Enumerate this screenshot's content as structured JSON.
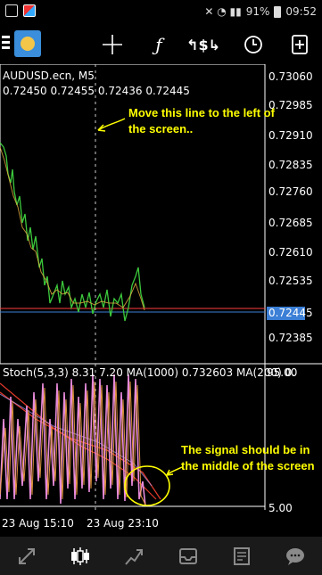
{
  "status_bar": {
    "battery": "91%",
    "time": "09:52"
  },
  "toolbar": {
    "crosshair_icon": "crosshair-icon",
    "indicators_icon": "function-icon",
    "trade_icon": "dollar-arrows-icon",
    "timeframe_icon": "clock-icon",
    "add_icon": "add-document-icon"
  },
  "chart": {
    "instrument": "AUDUSD.ecn, M5",
    "ohlc": "0.72450 0.72455 0.72436 0.72445",
    "current_price": "0.72445",
    "price_axis": [
      "0.73060",
      "0.72985",
      "0.72910",
      "0.72835",
      "0.72760",
      "0.72685",
      "0.72610",
      "0.72535",
      "0.72385"
    ],
    "stoch_label": "Stoch(5,3,3) 8.31 7.20 MA(1000) 0.732603 MA(200) 0.",
    "stoch_axis_top": "95.00",
    "stoch_axis_bottom": "5.00",
    "time_labels": [
      "23 Aug 15:10",
      "23 Aug 23:10"
    ],
    "colors": {
      "bid_line": "#ff3b3b",
      "ask_line": "#3b7fd6",
      "ma_red": "#e23a2a",
      "stoch_pink": "#e68ad9",
      "stoch_orange": "#f0a040",
      "annotation": "#ffff00"
    }
  },
  "annotations": {
    "move_line": "Move this line to the left of the screen..",
    "signal_middle": "The signal should be in the middle of the screen"
  },
  "bottom_nav": {
    "items": [
      "quotes-icon",
      "chart-candles-icon",
      "trade-icon",
      "history-inbox-icon",
      "news-icon",
      "chat-icon"
    ]
  }
}
